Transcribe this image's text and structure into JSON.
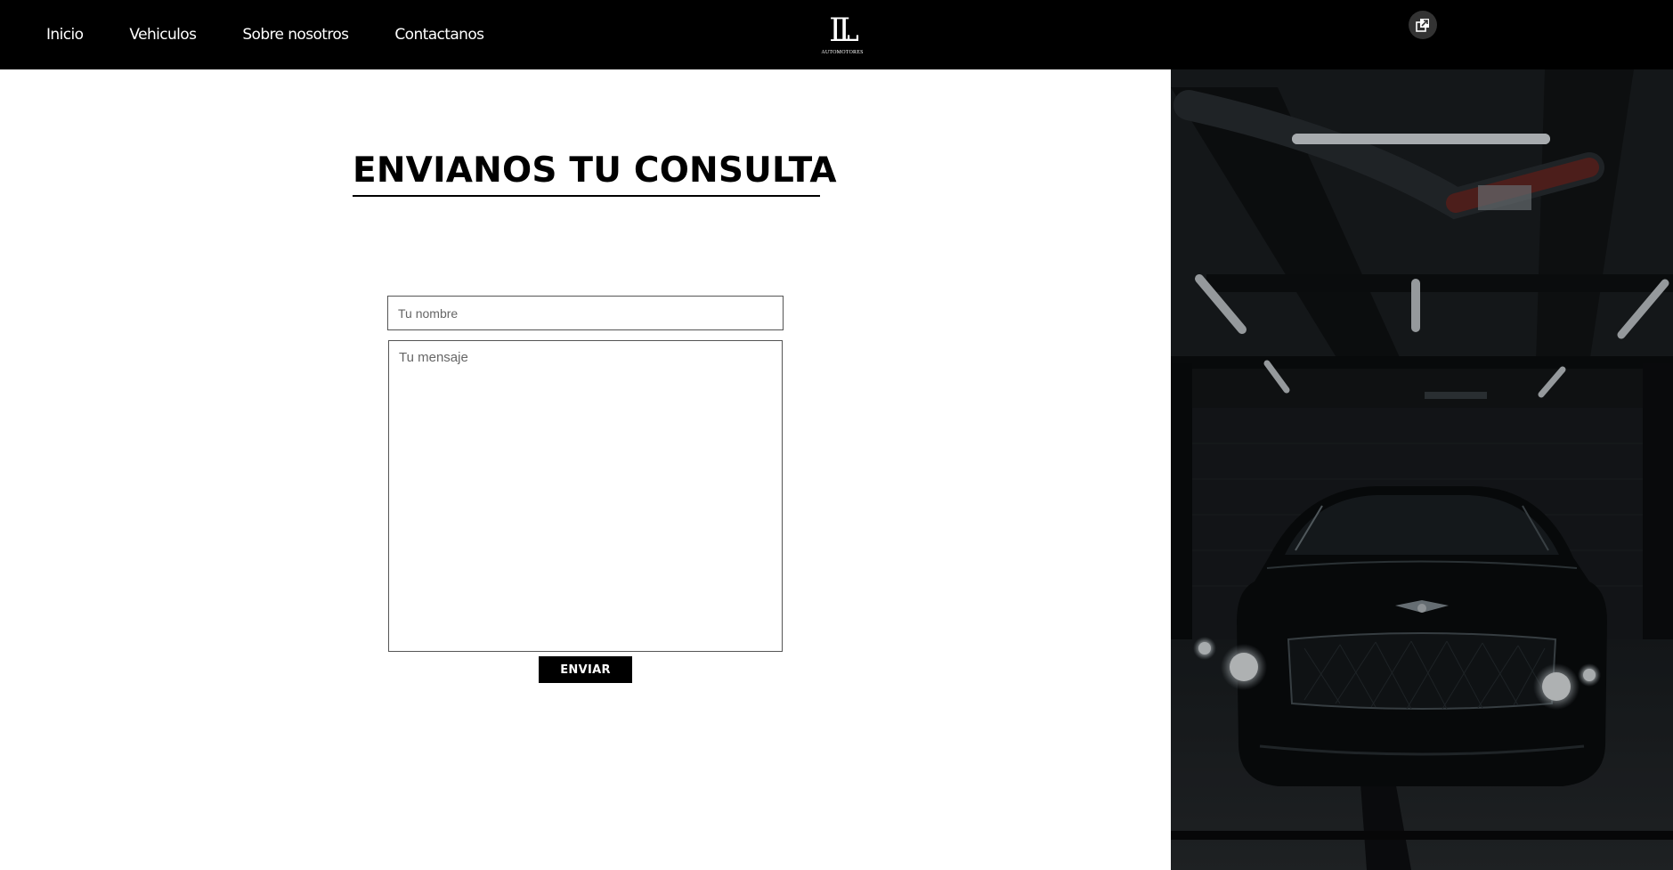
{
  "header": {
    "nav": [
      {
        "label": "Inicio"
      },
      {
        "label": "Vehiculos"
      },
      {
        "label": "Sobre nosotros"
      },
      {
        "label": "Contactanos"
      }
    ],
    "logo": {
      "mark": "LL",
      "subtitle": "AUTOMOTORES"
    },
    "gallery_button_icon": "gallery-icon"
  },
  "contact": {
    "heading": "ENVIANOS TU CONSULTA",
    "name_placeholder": "Tu nombre",
    "name_value": "",
    "message_placeholder": "Tu mensaje",
    "message_value": "",
    "submit_label": "ENVIAR"
  },
  "hero_image": {
    "subject": "car-photo",
    "icon": "image-icon"
  },
  "colors": {
    "header_bg": "#000000",
    "page_bg": "#ffffff",
    "button_bg": "#000000",
    "text_light": "#ffffff",
    "text_dark": "#000000"
  }
}
